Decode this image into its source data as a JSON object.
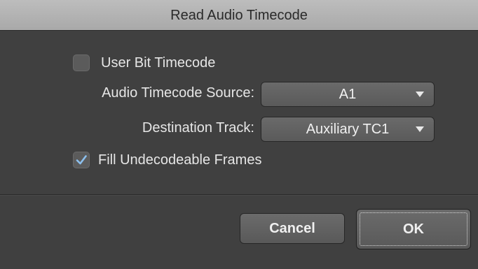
{
  "dialog": {
    "title": "Read Audio Timecode",
    "user_bit": {
      "label": "User Bit Timecode",
      "checked": false
    },
    "audio_source": {
      "label": "Audio Timecode Source:",
      "value": "A1"
    },
    "destination": {
      "label": "Destination Track:",
      "value": "Auxiliary TC1"
    },
    "fill_frames": {
      "label": "Fill Undecodeable Frames",
      "checked": true
    },
    "cancel_label": "Cancel",
    "ok_label": "OK"
  },
  "icons": {
    "dropdown": "chevron-down-icon",
    "check": "checkmark-icon"
  },
  "colors": {
    "background": "#404040",
    "titlebar": "#b3b3b3",
    "text": "#e6e6e6",
    "check_accent": "#6fa8dc"
  }
}
